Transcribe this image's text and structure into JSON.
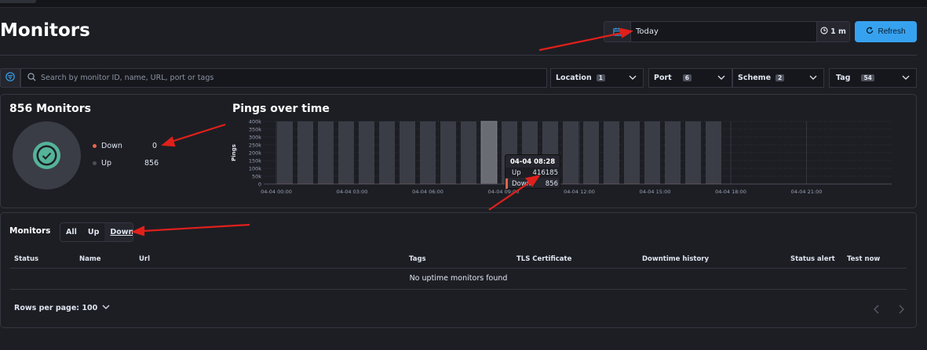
{
  "header": {
    "title": "Monitors",
    "date_value": "Today",
    "refresh_interval": "1 m",
    "refresh_label": "Refresh"
  },
  "filters": {
    "search_placeholder": "Search by monitor ID, name, URL, port or tags",
    "dropdowns": [
      {
        "label": "Location",
        "count": "1"
      },
      {
        "label": "Port",
        "count": "6"
      },
      {
        "label": "Scheme",
        "count": "2"
      },
      {
        "label": "Tag",
        "count": "54"
      }
    ]
  },
  "summary": {
    "title": "856 Monitors",
    "down_label": "Down",
    "down_value": "0",
    "up_label": "Up",
    "up_value": "856"
  },
  "chart_data": {
    "type": "bar",
    "title": "Pings over time",
    "ylabel": "Pings",
    "xlabel": "",
    "ylim": [
      0,
      400000
    ],
    "y_ticks": [
      "400k",
      "350k",
      "300k",
      "250k",
      "200k",
      "150k",
      "100k",
      "50k",
      "0"
    ],
    "x_ticks": [
      "04-04 00:00",
      "04-04 03:00",
      "04-04 06:00",
      "04-04 09:00",
      "04-04 12:00",
      "04-04 15:00",
      "04-04 18:00",
      "04-04 21:00"
    ],
    "series": [
      {
        "name": "Up",
        "values": [
          400000,
          416185,
          416185,
          416185,
          416185,
          416185,
          416185,
          416185,
          416185,
          416185,
          416185,
          416185,
          416185,
          416185,
          416185,
          416185,
          416185,
          416185,
          416185,
          416185,
          416185,
          400000
        ]
      },
      {
        "name": "Down",
        "values": [
          856,
          856,
          856,
          856,
          856,
          856,
          856,
          856,
          856,
          856,
          856,
          856,
          856,
          856,
          856,
          856,
          856,
          856,
          856,
          856,
          856,
          856
        ]
      }
    ],
    "highlight_index": 10,
    "tooltip": {
      "title": "04-04 08:28",
      "up_label": "Up",
      "up_value": "416185",
      "down_label": "Down",
      "down_value": "856"
    }
  },
  "monitors_table": {
    "title": "Monitors",
    "status_filters": [
      "All",
      "Up",
      "Down"
    ],
    "active_filter": "Down",
    "columns": [
      "Status",
      "Name",
      "Url",
      "Tags",
      "TLS Certificate",
      "Downtime history",
      "Status alert",
      "Test now"
    ],
    "empty_message": "No uptime monitors found",
    "rows_per_page": "Rows per page: 100"
  },
  "colors": {
    "accent": "#36a2ef",
    "up": "#54b399",
    "down": "#e7664c",
    "annotation_arrow": "#e0201b"
  },
  "icons": [
    "calendar-icon",
    "clock-icon",
    "refresh-icon",
    "filter-icon",
    "search-icon",
    "chevron-down-icon",
    "check-icon",
    "chevron-left-icon",
    "chevron-right-icon"
  ]
}
